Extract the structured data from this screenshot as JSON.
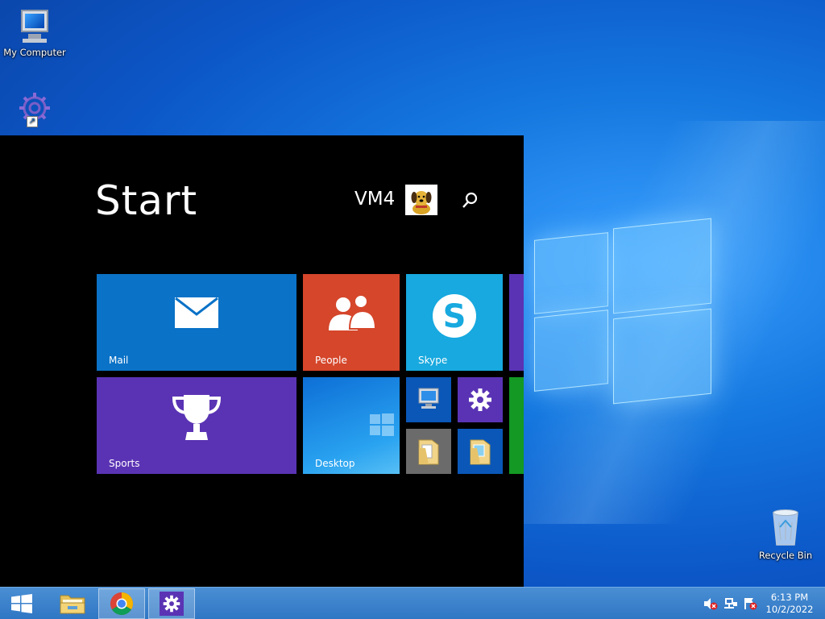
{
  "desktop": {
    "icons": [
      {
        "label": "My Computer"
      },
      {
        "label": "Recycle Bin"
      }
    ]
  },
  "start": {
    "title": "Start",
    "user_name": "VM4",
    "tiles": {
      "mail": "Mail",
      "people": "People",
      "skype": "Skype",
      "sports": "Sports",
      "desktop": "Desktop"
    }
  },
  "taskbar": {
    "clock_time": "6:13 PM",
    "clock_date": "10/2/2022"
  },
  "colors": {
    "mail_tile": "#0a72c7",
    "people_tile": "#d5462b",
    "skype_tile": "#17a9df",
    "sports_tile": "#5a33b4",
    "desktop_tile": "#1a88d8",
    "purple_tile": "#5a33b4",
    "green_tile": "#139924"
  }
}
